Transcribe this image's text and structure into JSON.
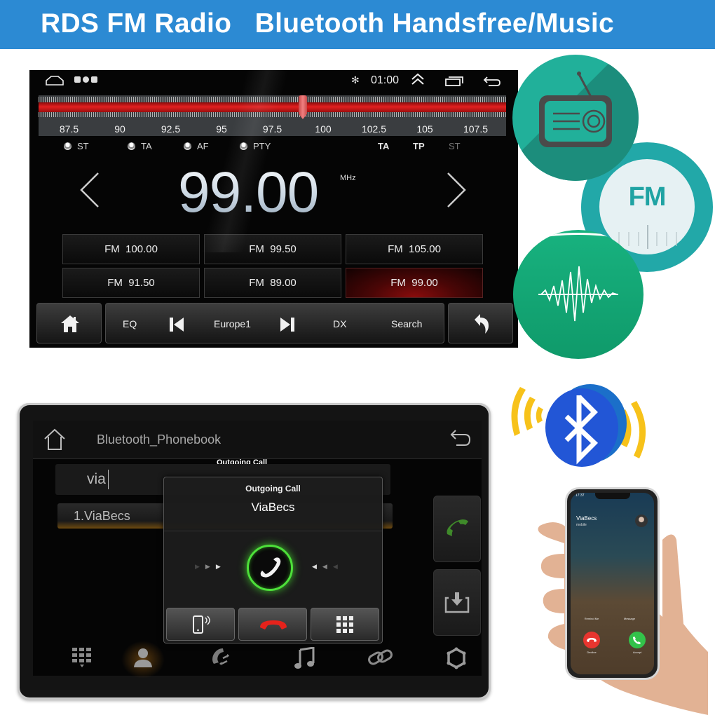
{
  "banner": {
    "title": "RDS FM Radio   Bluetooth Handsfree/Music",
    "color": "#2c8ad3"
  },
  "radio": {
    "status_bar": {
      "icons": [
        "home-outline-icon",
        "app-icon",
        "app-icon",
        "app-icon",
        "bluetooth-icon",
        "double-chevron-up-icon",
        "recent-apps-icon",
        "back-icon"
      ],
      "time": "01:00"
    },
    "tuner": {
      "labels": [
        "87.5",
        "90",
        "92.5",
        "95",
        "97.5",
        "100",
        "102.5",
        "105",
        "107.5"
      ],
      "min_mhz": 86.0,
      "max_mhz": 109.0,
      "current_mhz": 99.0
    },
    "rds_toggles": [
      "ST",
      "TA",
      "AF",
      "PTY"
    ],
    "rds_flags": [
      {
        "label": "TA",
        "active": true
      },
      {
        "label": "TP",
        "active": true
      },
      {
        "label": "ST",
        "active": false
      }
    ],
    "frequency": "99.00",
    "unit": "MHz",
    "presets": [
      {
        "label": "FM  100.00",
        "active": false
      },
      {
        "label": "FM  99.50",
        "active": false
      },
      {
        "label": "FM  105.00",
        "active": false
      },
      {
        "label": "FM  91.50",
        "active": false
      },
      {
        "label": "FM  89.00",
        "active": false
      },
      {
        "label": "FM  99.00",
        "active": true
      }
    ],
    "controls": {
      "eq": "EQ",
      "station": "Europe1",
      "dx": "DX",
      "search": "Search"
    },
    "accent_color": "#e22020"
  },
  "feature_icons": {
    "fm_label": "FM",
    "radio_color": "#21b09a",
    "fm_color": "#22a8a8",
    "wave_color": "#18b27f"
  },
  "phonebook": {
    "title": "Bluetooth_Phonebook",
    "search_value": "via",
    "overlay_title": "Outgoing Call",
    "contacts": [
      "1.ViaBecs"
    ],
    "dialog": {
      "title": "Outgoing Call",
      "name": "ViaBecs"
    },
    "nav_icons": [
      "dialpad-icon",
      "contacts-icon",
      "call-transfer-icon",
      "music-icon",
      "link-icon",
      "settings-icon"
    ],
    "active_nav": 1
  },
  "phone": {
    "time": "17:37",
    "caller": "ViaBecs",
    "caller_sub": "mobile",
    "remind_label": "Remind Me",
    "message_label": "Message",
    "decline_label": "Decline",
    "accept_label": "Accept"
  }
}
